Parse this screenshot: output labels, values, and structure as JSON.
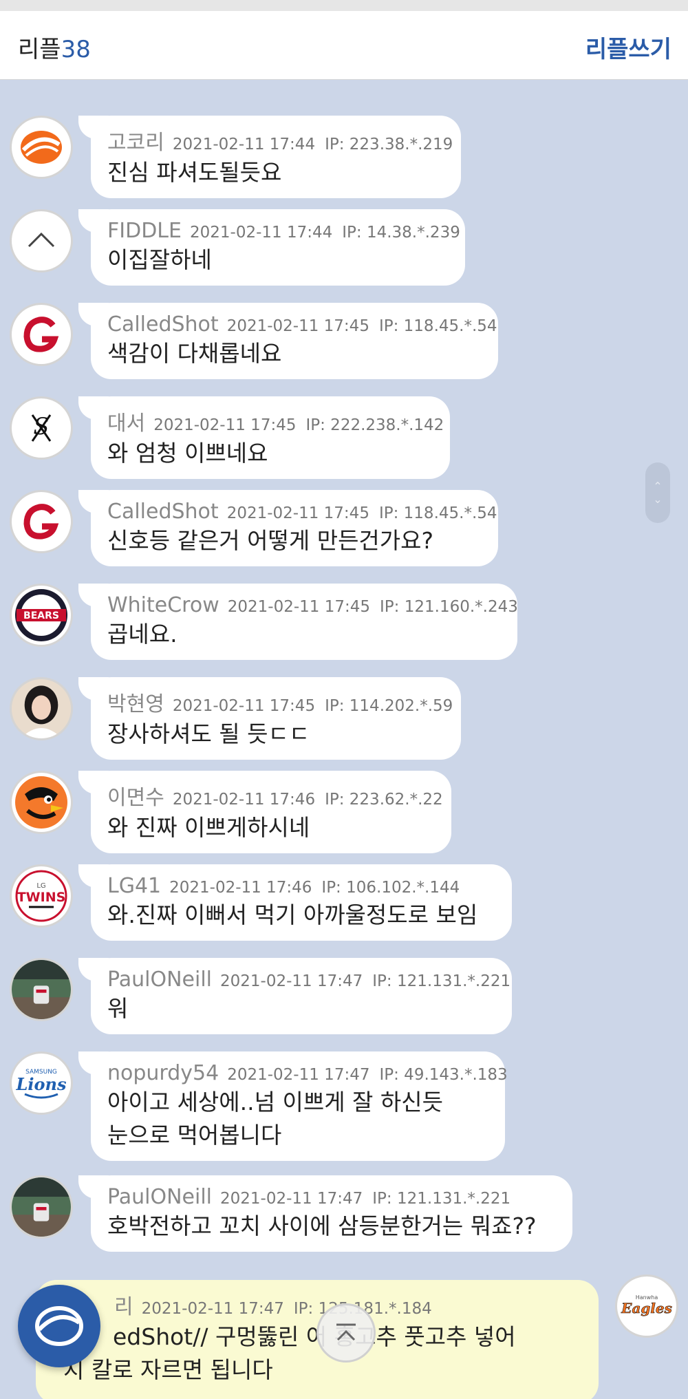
{
  "header": {
    "title_prefix": "리플",
    "count": "38",
    "write_label": "리플쓰기"
  },
  "comments": [
    {
      "nick": "고코리",
      "date": "2021-02-11 17:44",
      "ip": "IP: 223.38.*.219",
      "lines": [
        "진심 파셔도될듯요"
      ],
      "avatar": "orange-ball-logo"
    },
    {
      "nick": "FIDDLE",
      "date": "2021-02-11 17:44",
      "ip": "IP: 14.38.*.239",
      "lines": [
        "이집잘하네"
      ],
      "avatar": "chevron-up-icon"
    },
    {
      "nick": "CalledShot",
      "date": "2021-02-11 17:45",
      "ip": "IP: 118.45.*.54",
      "lines": [
        "색감이 다채롭네요"
      ],
      "avatar": "giants-g-logo"
    },
    {
      "nick": "대서",
      "date": "2021-02-11 17:45",
      "ip": "IP: 222.238.*.142",
      "lines": [
        "와 엄청 이쁘네요"
      ],
      "avatar": "white-sox-logo"
    },
    {
      "nick": "CalledShot",
      "date": "2021-02-11 17:45",
      "ip": "IP: 118.45.*.54",
      "lines": [
        "신호등 같은거 어떻게 만든건가요?"
      ],
      "avatar": "giants-g-logo"
    },
    {
      "nick": "WhiteCrow",
      "date": "2021-02-11 17:45",
      "ip": "IP: 121.160.*.243",
      "lines": [
        "곱네요."
      ],
      "avatar": "bears-logo"
    },
    {
      "nick": "박현영",
      "date": "2021-02-11 17:45",
      "ip": "IP: 114.202.*.59",
      "lines": [
        "장사하셔도 될 듯ㄷㄷ"
      ],
      "avatar": "profile-photo"
    },
    {
      "nick": "이면수",
      "date": "2021-02-11 17:46",
      "ip": "IP: 223.62.*.22",
      "lines": [
        "와 진짜 이쁘게하시네"
      ],
      "avatar": "orioles-logo"
    },
    {
      "nick": "LG41",
      "date": "2021-02-11 17:46",
      "ip": "IP: 106.102.*.144",
      "lines": [
        "와.진짜 이뻐서 먹기 아까울정도로 보임"
      ],
      "avatar": "twins-logo"
    },
    {
      "nick": "PaulONeill",
      "date": "2021-02-11 17:47",
      "ip": "IP: 121.131.*.221",
      "lines": [
        "워"
      ],
      "avatar": "stadium-photo"
    },
    {
      "nick": "nopurdy54",
      "date": "2021-02-11 17:47",
      "ip": "IP: 49.143.*.183",
      "lines": [
        "아이고 세상에..넘 이쁘게 잘 하신듯",
        "눈으로 먹어봅니다"
      ],
      "avatar": "lions-logo"
    },
    {
      "nick": "PaulONeill",
      "date": "2021-02-11 17:47",
      "ip": "IP: 121.131.*.221",
      "lines": [
        "호박전하고 꼬치 사이에 삼등분한거는 뭐죠??"
      ],
      "avatar": "stadium-photo"
    }
  ],
  "my_comment": {
    "nick": "리",
    "date": "2021-02-11 17:47",
    "ip": "IP: 125.181.*.184",
    "lines": [
      "edShot// 구멍뚫린 어      홍고추 풋고추 넣어",
      "지 칼로 자르면 됩니다"
    ],
    "avatar": "eagles-logo"
  },
  "avatar_logo_text": {
    "bears": "BEARS",
    "twins": "TWINS",
    "lg": "LG",
    "lions": "Lions",
    "samsung": "SAMSUNG",
    "eagles": "Eagles",
    "hanwha": "Hanwha"
  },
  "colors": {
    "background": "#ccd6e8",
    "accent": "#2b5ca8",
    "bubble": "#ffffff",
    "my_bubble": "#fafad2"
  }
}
